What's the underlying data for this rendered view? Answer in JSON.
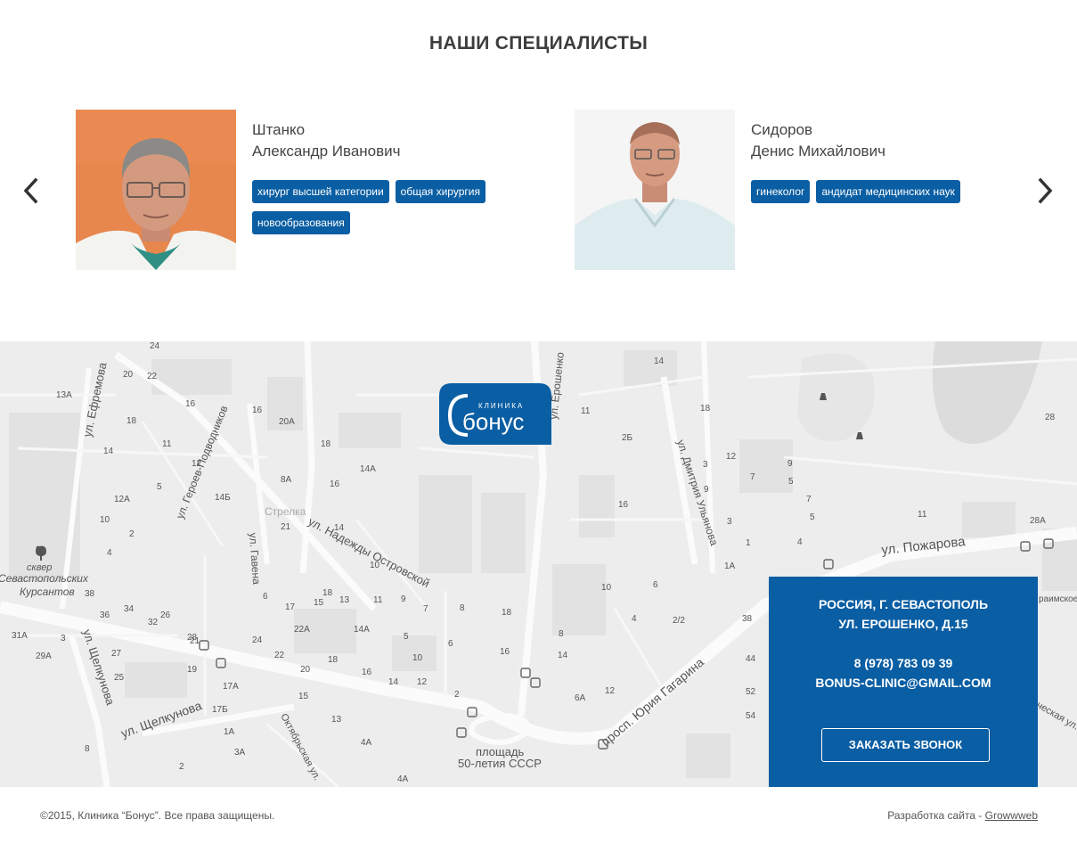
{
  "section": {
    "title": "НАШИ СПЕЦИАЛИСТЫ"
  },
  "doctors": [
    {
      "surname": "Штанко",
      "given": "Александр Иванович",
      "tags": [
        "хирург высшей категории",
        "общая хирургия",
        "новообразования"
      ]
    },
    {
      "surname": "Сидоров",
      "given": "Денис Михайлович",
      "tags": [
        "гинеколог",
        "андидат медицинских наук"
      ]
    }
  ],
  "map": {
    "logo": {
      "small": "КЛИНИКА",
      "big": "бонус"
    },
    "streets": [
      "ул. Ефремова",
      "ул. Героев-Подводников",
      "ул. Гавена",
      "ул. Надежды Островской",
      "ул. Ерошенко",
      "ул. Дмитрия Ульянова",
      "ул. Пожарова",
      "просп. Юрия Гагарина",
      "ул. Щелкунова",
      "ул. Щелкунова",
      "Октябрьская ул.",
      "площадь",
      "50-летия СССР",
      "сквер",
      "Севастопольских",
      "Курсантов",
      "Стрелка",
      "чеcкая ул.",
      "раимское"
    ],
    "numbers": [
      "24",
      "20",
      "22",
      "13А",
      "16",
      "18",
      "11",
      "12",
      "14",
      "5",
      "12А",
      "10",
      "2",
      "4",
      "16",
      "20А",
      "18",
      "14А",
      "8А",
      "14Б",
      "21",
      "14",
      "16",
      "18",
      "10",
      "13",
      "11",
      "9",
      "7",
      "8",
      "17",
      "15",
      "6",
      "22А",
      "14А",
      "5",
      "22",
      "20",
      "18",
      "16",
      "14",
      "12",
      "10",
      "13",
      "15",
      "17А",
      "17Б",
      "19",
      "21",
      "25",
      "27",
      "28",
      "26",
      "24",
      "36",
      "34",
      "32",
      "38",
      "3",
      "31А",
      "29А",
      "8",
      "1А",
      "3А",
      "2",
      "4А",
      "4А",
      "18",
      "16",
      "14",
      "12",
      "8",
      "6",
      "10",
      "4",
      "2",
      "6",
      "6А",
      "2/2",
      "38",
      "44",
      "52",
      "54",
      "1А",
      "1",
      "3",
      "5",
      "7",
      "9",
      "11",
      "28А",
      "28",
      "2Б",
      "14",
      "18",
      "11",
      "16",
      "12",
      "3",
      "9",
      "7",
      "5",
      "4",
      "2"
    ]
  },
  "contact": {
    "address_line1": "РОССИЯ, Г. СЕВАСТОПОЛЬ",
    "address_line2": "УЛ. ЕРОШЕНКО, Д.15",
    "phone": "8 (978) 783 09 39",
    "email": "BONUS-CLINIC@GMAIL.COM",
    "call_button": "ЗАКАЗАТЬ ЗВОНОК"
  },
  "footer": {
    "copyright": "©2015, Клиника “Бонус”. Все права защищены.",
    "dev_label": "Разработка сайта - ",
    "dev_link": "Growwweb"
  },
  "colors": {
    "brand_blue": "#0a5ea3",
    "map_bg": "#efefef"
  },
  "icons": {
    "prev": "chevron-left-icon",
    "next": "chevron-right-icon"
  }
}
